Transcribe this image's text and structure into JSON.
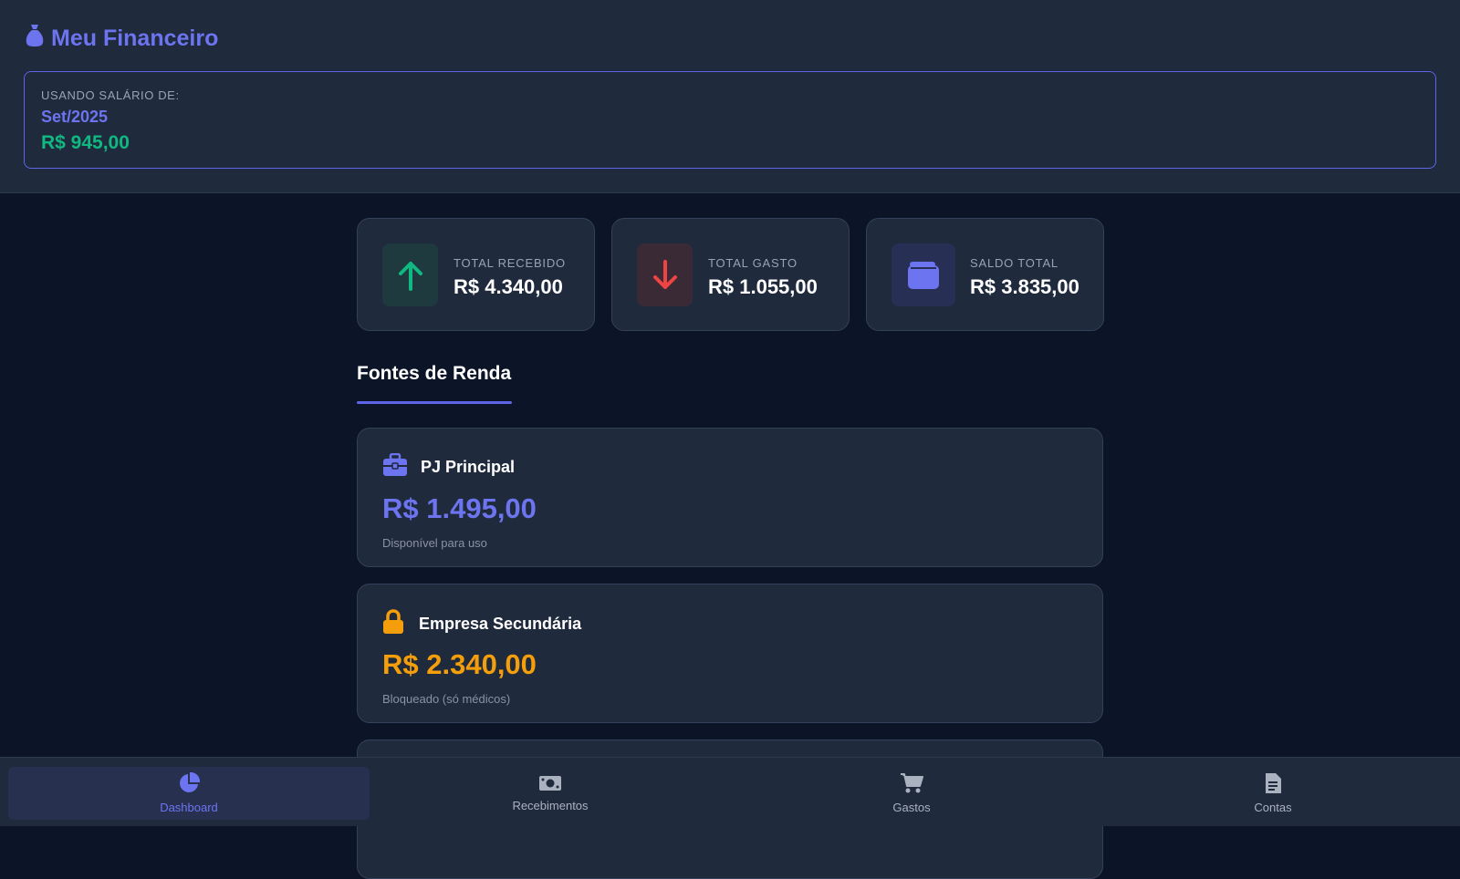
{
  "header": {
    "app_title": "Meu Financeiro",
    "salary_label": "USANDO SALÁRIO DE:",
    "salary_month": "Set/2025",
    "salary_value": "R$ 945,00"
  },
  "stats": [
    {
      "label": "TOTAL RECEBIDO",
      "value": "R$ 4.340,00",
      "icon": "arrow-up-icon"
    },
    {
      "label": "TOTAL GASTO",
      "value": "R$ 1.055,00",
      "icon": "arrow-down-icon"
    },
    {
      "label": "SALDO TOTAL",
      "value": "R$ 3.835,00",
      "icon": "wallet-icon"
    }
  ],
  "section": {
    "title": "Fontes de Renda"
  },
  "sources": [
    {
      "name": "PJ Principal",
      "value": "R$ 1.495,00",
      "note": "Disponível para uso",
      "icon": "briefcase-icon",
      "color": "#6d74f0"
    },
    {
      "name": "Empresa Secundária",
      "value": "R$ 2.340,00",
      "note": "Bloqueado (só médicos)",
      "icon": "lock-icon",
      "color": "#f59e0b"
    }
  ],
  "nav": [
    {
      "label": "Dashboard",
      "icon": "pie-chart-icon",
      "active": true
    },
    {
      "label": "Recebimentos",
      "icon": "money-bill-icon",
      "active": false
    },
    {
      "label": "Gastos",
      "icon": "cart-icon",
      "active": false
    },
    {
      "label": "Contas",
      "icon": "document-icon",
      "active": false
    }
  ],
  "colors": {
    "accent": "#6d74f0",
    "success": "#10b981",
    "danger": "#ef4444",
    "warning": "#f59e0b"
  }
}
